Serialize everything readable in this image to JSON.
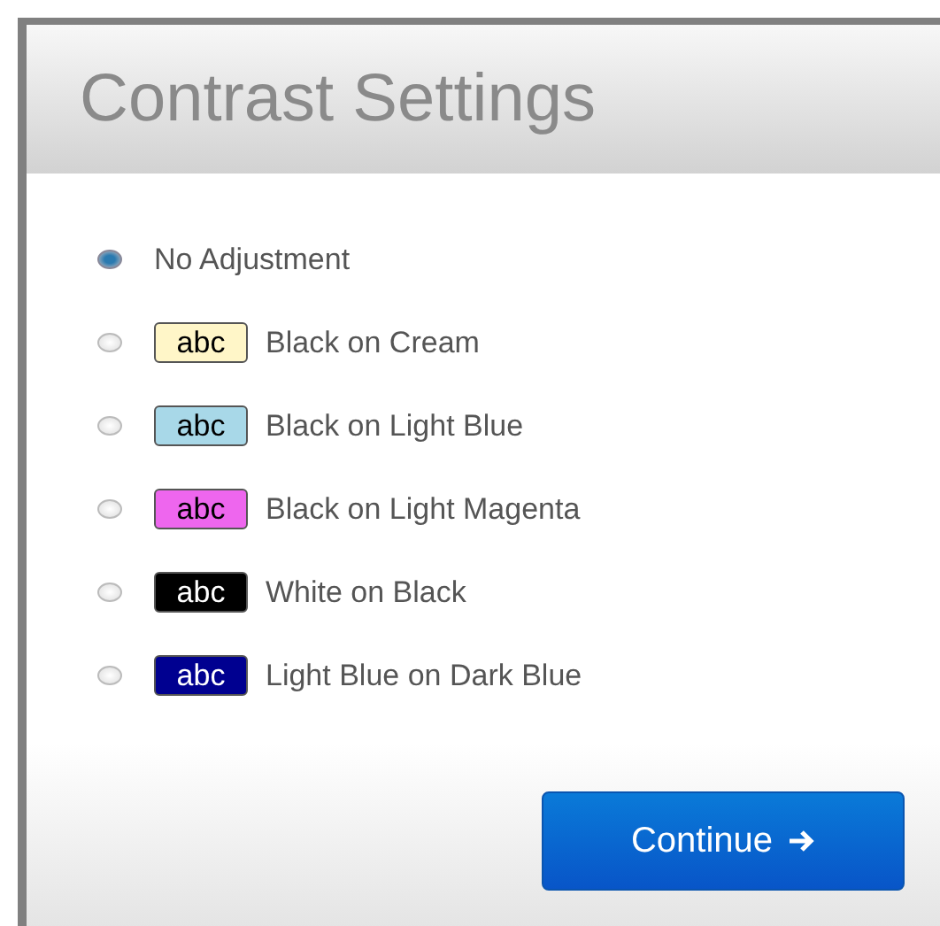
{
  "dialog": {
    "title": "Contrast Settings"
  },
  "options": [
    {
      "kind": "plain",
      "label": "No Adjustment",
      "selected": true
    },
    {
      "kind": "swatch",
      "sample": "abc",
      "color": "#fff6c8",
      "label": "Black on Cream",
      "selected": false
    },
    {
      "kind": "swatch",
      "sample": "abc",
      "color": "#a8d8e8",
      "label": "Black on Light Blue",
      "selected": false
    },
    {
      "kind": "swatch",
      "sample": "abc",
      "color": "#ee66ee",
      "label": "Black on Light Magenta",
      "selected": false
    },
    {
      "kind": "swatch",
      "sample": "abc",
      "color": "#000000",
      "label": "White on Black",
      "selected": false
    },
    {
      "kind": "swatch",
      "sample": "abc",
      "color": "#000090",
      "label": "Light Blue on Dark Blue",
      "selected": false
    }
  ],
  "continue_button": {
    "label": "Continue"
  }
}
